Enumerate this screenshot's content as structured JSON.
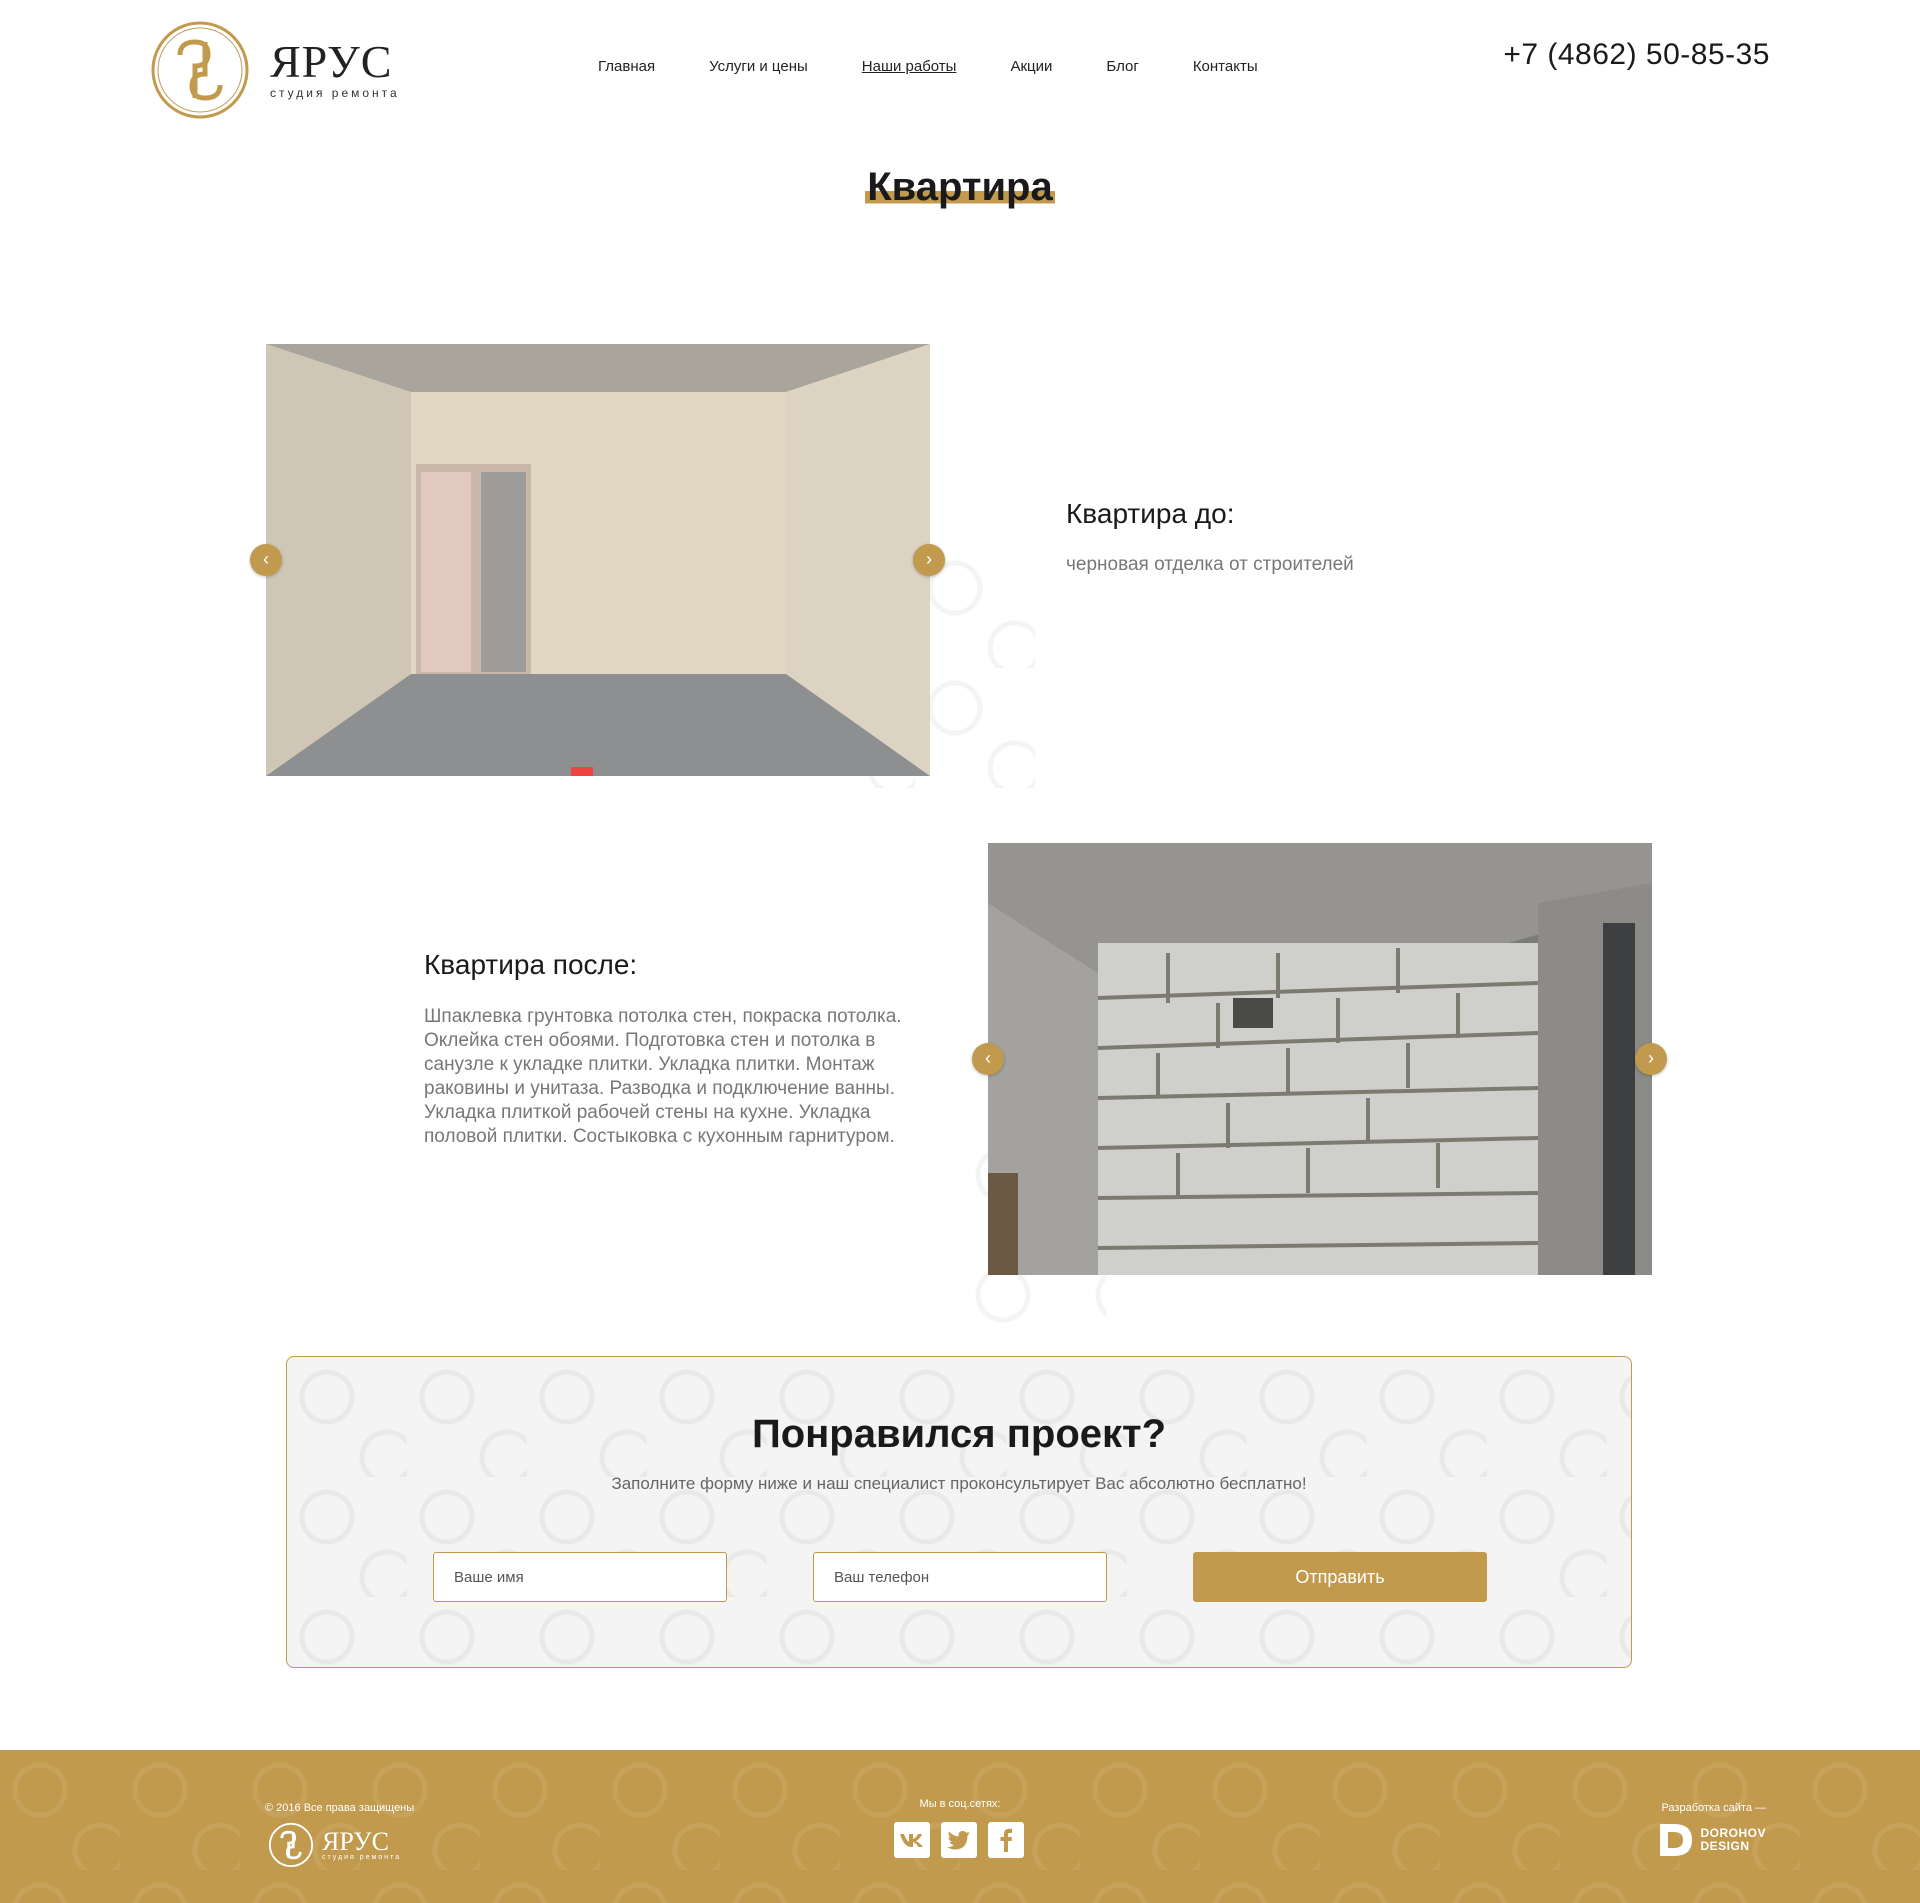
{
  "header": {
    "logo_name": "ЯРУС",
    "logo_sub": "студия ремонта",
    "nav": [
      {
        "label": "Главная"
      },
      {
        "label": "Услуги и цены"
      },
      {
        "label": "Наши работы"
      },
      {
        "label": "Акции"
      },
      {
        "label": "Блог"
      },
      {
        "label": "Контакты"
      }
    ],
    "active_nav": "Наши работы",
    "phone": "+7 (4862) 50-85-35"
  },
  "page": {
    "title": "Квартира"
  },
  "before": {
    "title": "Квартира до:",
    "description": "черновая отделка от строителей"
  },
  "after": {
    "title": "Квартира после:",
    "description": "Шпаклевка грунтовка потолка стен, покраска потолка. Оклейка стен обоями. Подготовка стен и потолка в санузле к укладке плитки. Укладка плитки. Монтаж раковины и унитаза. Разводка и подключение ванны. Укладка плиткой рабочей стены на кухне. Укладка половой плитки. Состыковка с кухонным гарнитуром."
  },
  "cta": {
    "title": "Понравился проект?",
    "subtitle": "Заполните форму ниже и наш специалист проконсультирует Вас абсолютно бесплатно!",
    "name_placeholder": "Ваше имя",
    "phone_placeholder": "Ваш телефон",
    "submit_label": "Отправить"
  },
  "footer": {
    "copyright": "© 2016 Все права защищены",
    "logo_name": "ЯРУС",
    "logo_sub": "студия ремонта",
    "social_label": "Мы в соц.сетях:",
    "social": [
      "vk-icon",
      "twitter-icon",
      "facebook-icon"
    ],
    "dev_label": "Разработка сайта —",
    "dev_name_line1": "DOROHOV",
    "dev_name_line2": "DESIGN"
  },
  "colors": {
    "accent": "#c19a4d",
    "text": "#1a1a1a",
    "muted": "#777777"
  }
}
